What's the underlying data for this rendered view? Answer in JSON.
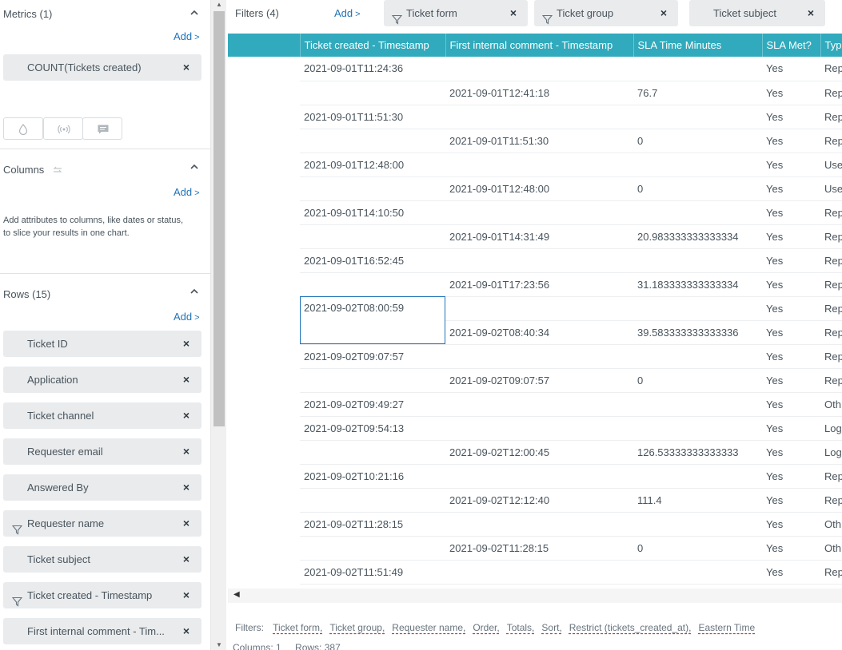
{
  "sidebar": {
    "metrics": {
      "title": "Metrics (1)",
      "add": "Add",
      "items": [
        {
          "label": "COUNT(Tickets created)"
        }
      ]
    },
    "columns": {
      "title": "Columns",
      "add": "Add",
      "hint": "Add attributes to columns, like dates or status, to slice your results in one chart."
    },
    "rows": {
      "title": "Rows (15)",
      "add": "Add",
      "items": [
        {
          "label": "Ticket ID",
          "filtered": false
        },
        {
          "label": "Application",
          "filtered": false
        },
        {
          "label": "Ticket channel",
          "filtered": false
        },
        {
          "label": "Requester email",
          "filtered": false
        },
        {
          "label": "Answered By",
          "filtered": false
        },
        {
          "label": "Requester name",
          "filtered": true
        },
        {
          "label": "Ticket subject",
          "filtered": false
        },
        {
          "label": "Ticket created - Timestamp",
          "filtered": true
        },
        {
          "label": "First internal comment - Tim...",
          "filtered": false
        }
      ]
    },
    "remove_glyph": "×"
  },
  "filters": {
    "label": "Filters (4)",
    "add": "Add",
    "items": [
      {
        "label": "Ticket form",
        "filtered": true
      },
      {
        "label": "Ticket group",
        "filtered": true
      },
      {
        "label": "Ticket subject",
        "filtered": false
      }
    ]
  },
  "table": {
    "headers": [
      "",
      "Ticket created - Timestamp",
      "First internal comment - Timestamp",
      "SLA Time Minutes",
      "SLA Met?",
      "Type"
    ],
    "rows": [
      [
        "",
        "2021-09-01T11:24:36",
        "",
        "",
        "Yes",
        "Rep"
      ],
      [
        "",
        "",
        "2021-09-01T12:41:18",
        "76.7",
        "Yes",
        "Rep"
      ],
      [
        "",
        "2021-09-01T11:51:30",
        "",
        "",
        "Yes",
        "Rep"
      ],
      [
        "",
        "",
        "2021-09-01T11:51:30",
        "0",
        "Yes",
        "Rep"
      ],
      [
        "",
        "2021-09-01T12:48:00",
        "",
        "",
        "Yes",
        "Use"
      ],
      [
        "",
        "",
        "2021-09-01T12:48:00",
        "0",
        "Yes",
        "Use"
      ],
      [
        "",
        "2021-09-01T14:10:50",
        "",
        "",
        "Yes",
        "Rep"
      ],
      [
        "",
        "",
        "2021-09-01T14:31:49",
        "20.983333333333334",
        "Yes",
        "Rep"
      ],
      [
        "",
        "2021-09-01T16:52:45",
        "",
        "",
        "Yes",
        "Rep"
      ],
      [
        "",
        "",
        "2021-09-01T17:23:56",
        "31.183333333333334",
        "Yes",
        "Rep"
      ],
      [
        "",
        "2021-09-02T08:00:59",
        "",
        "",
        "Yes",
        "Rep"
      ],
      [
        "",
        "",
        "2021-09-02T08:40:34",
        "39.583333333333336",
        "Yes",
        "Rep"
      ],
      [
        "",
        "2021-09-02T09:07:57",
        "",
        "",
        "Yes",
        "Rep"
      ],
      [
        "",
        "",
        "2021-09-02T09:07:57",
        "0",
        "Yes",
        "Rep"
      ],
      [
        "",
        "2021-09-02T09:49:27",
        "",
        "",
        "Yes",
        "Oth"
      ],
      [
        "",
        "2021-09-02T09:54:13",
        "",
        "",
        "Yes",
        "Log"
      ],
      [
        "",
        "",
        "2021-09-02T12:00:45",
        "126.53333333333333",
        "Yes",
        "Log"
      ],
      [
        "",
        "2021-09-02T10:21:16",
        "",
        "",
        "Yes",
        "Rep"
      ],
      [
        "",
        "",
        "2021-09-02T12:12:40",
        "111.4",
        "Yes",
        "Rep"
      ],
      [
        "",
        "2021-09-02T11:28:15",
        "",
        "",
        "Yes",
        "Oth"
      ],
      [
        "",
        "",
        "2021-09-02T11:28:15",
        "0",
        "Yes",
        "Oth"
      ],
      [
        "",
        "2021-09-02T11:51:49",
        "",
        "",
        "Yes",
        "Rep"
      ]
    ],
    "selected_row": 10,
    "selected_col": 1
  },
  "footer": {
    "filters_label": "Filters:",
    "links": [
      "Ticket form,",
      "Ticket group,",
      "Requester name,",
      "Order,",
      "Totals,",
      "Sort,",
      "Restrict (tickets_created_at),",
      "Eastern Time"
    ],
    "columns_label": "Columns: 1",
    "rows_label": "Rows: 387"
  },
  "colors": {
    "accent": "#1f73b7",
    "header": "#30aabc",
    "pill": "#e9ebed"
  }
}
